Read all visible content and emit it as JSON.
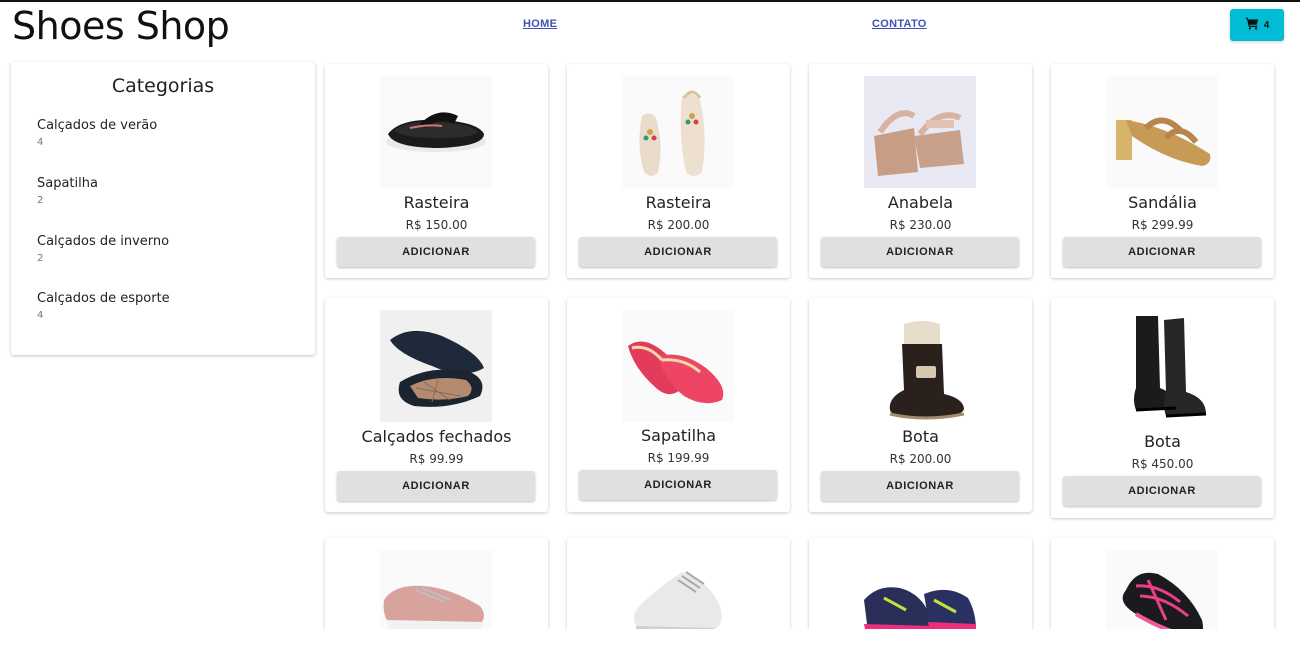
{
  "header": {
    "brand": "Shoes Shop",
    "nav": {
      "home": "HOME",
      "contato": "CONTATO"
    },
    "cart": {
      "count": "4",
      "icon": "shopping-cart-icon",
      "color": "#00bcd4"
    }
  },
  "sidebar": {
    "title": "Categorias",
    "items": [
      {
        "label": "Calçados de verão",
        "count": "4"
      },
      {
        "label": "Sapatilha",
        "count": "2"
      },
      {
        "label": "Calçados de inverno",
        "count": "2"
      },
      {
        "label": "Calçados de esporte",
        "count": "4"
      }
    ]
  },
  "products": [
    {
      "name": "Rasteira",
      "price": "R$ 150.00",
      "button": "ADICIONAR",
      "image": "black-flip-flop-sandal"
    },
    {
      "name": "Rasteira",
      "price": "R$ 200.00",
      "button": "ADICIONAR",
      "image": "beaded-flat-sandal"
    },
    {
      "name": "Anabela",
      "price": "R$ 230.00",
      "button": "ADICIONAR",
      "image": "wedge-sandal"
    },
    {
      "name": "Sandália",
      "price": "R$ 299.99",
      "button": "ADICIONAR",
      "image": "block-heel-sandal"
    },
    {
      "name": "Calçados fechados",
      "price": "R$ 99.99",
      "button": "ADICIONAR",
      "image": "quilted-flats"
    },
    {
      "name": "Sapatilha",
      "price": "R$ 199.99",
      "button": "ADICIONAR",
      "image": "pink-ballet-flats"
    },
    {
      "name": "Bota",
      "price": "R$ 200.00",
      "button": "ADICIONAR",
      "image": "fur-ankle-boot"
    },
    {
      "name": "Bota",
      "price": "R$ 450.00",
      "button": "ADICIONAR",
      "image": "tall-black-boots"
    },
    {
      "image": "pink-sneaker"
    },
    {
      "image": "white-sneaker"
    },
    {
      "image": "pink-navy-running-shoes"
    },
    {
      "image": "black-pink-running-shoe"
    }
  ]
}
